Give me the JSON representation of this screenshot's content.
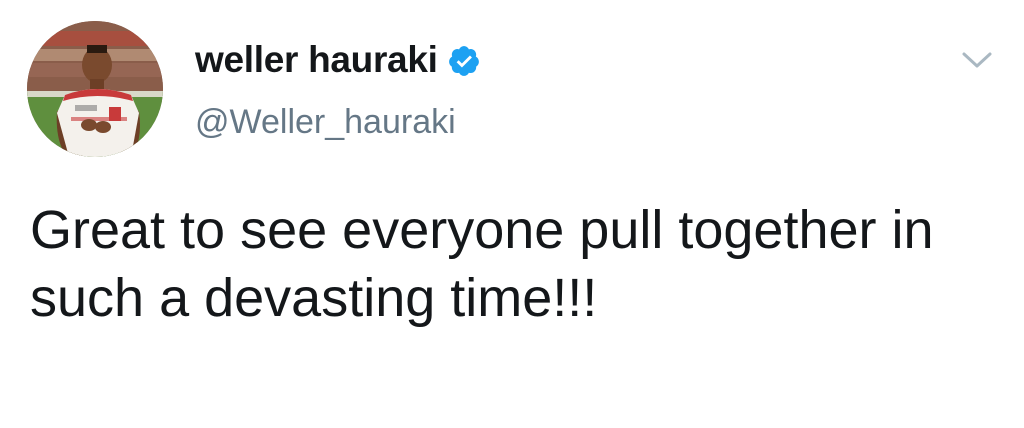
{
  "tweet": {
    "author": {
      "display_name": "weller hauraki",
      "handle": "@Weller_hauraki",
      "verified": true,
      "avatar_icon": "profile-photo"
    },
    "text": "Great to see everyone pull together in such a devasting time!!!",
    "menu_icon": "chevron-down-icon"
  },
  "colors": {
    "text_primary": "#14171a",
    "text_secondary": "#657786",
    "verified_blue": "#1da1f2",
    "chevron": "#aab8c2"
  }
}
